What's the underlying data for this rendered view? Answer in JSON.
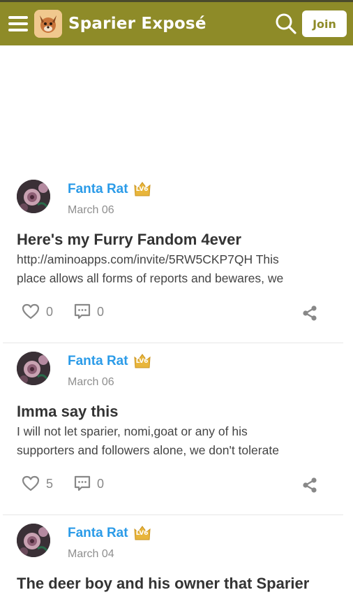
{
  "header": {
    "community_title": "Sparier Exposé",
    "join_label": "Join",
    "brand_color": "#8e8b28",
    "icons": [
      "menu-icon",
      "search-icon"
    ]
  },
  "posts": [
    {
      "author": "Fanta Rat",
      "level": "LV6",
      "date": "March 06",
      "title": "Here's my Furry Fandom 4ever",
      "excerpt_lines": [
        "http://aminoapps.com/invite/5RW5CKP7QH This",
        "place allows all forms of reports and bewares, we"
      ],
      "likes": "0",
      "comments": "0"
    },
    {
      "author": "Fanta Rat",
      "level": "LV6",
      "date": "March 06",
      "title": "Imma say this",
      "excerpt_lines": [
        "I will not let sparier, nomi,goat or any of his",
        "supporters and followers alone, we don't tolerate"
      ],
      "likes": "5",
      "comments": "0"
    },
    {
      "author": "Fanta Rat",
      "level": "LV6",
      "date": "March 04",
      "title": "The deer boy and his owner that Sparier",
      "excerpt_lines": [],
      "likes": "",
      "comments": ""
    }
  ],
  "colors": {
    "author_link": "#2b9be8",
    "level_badge": "#e8b53b",
    "muted": "#8f8f8f"
  }
}
